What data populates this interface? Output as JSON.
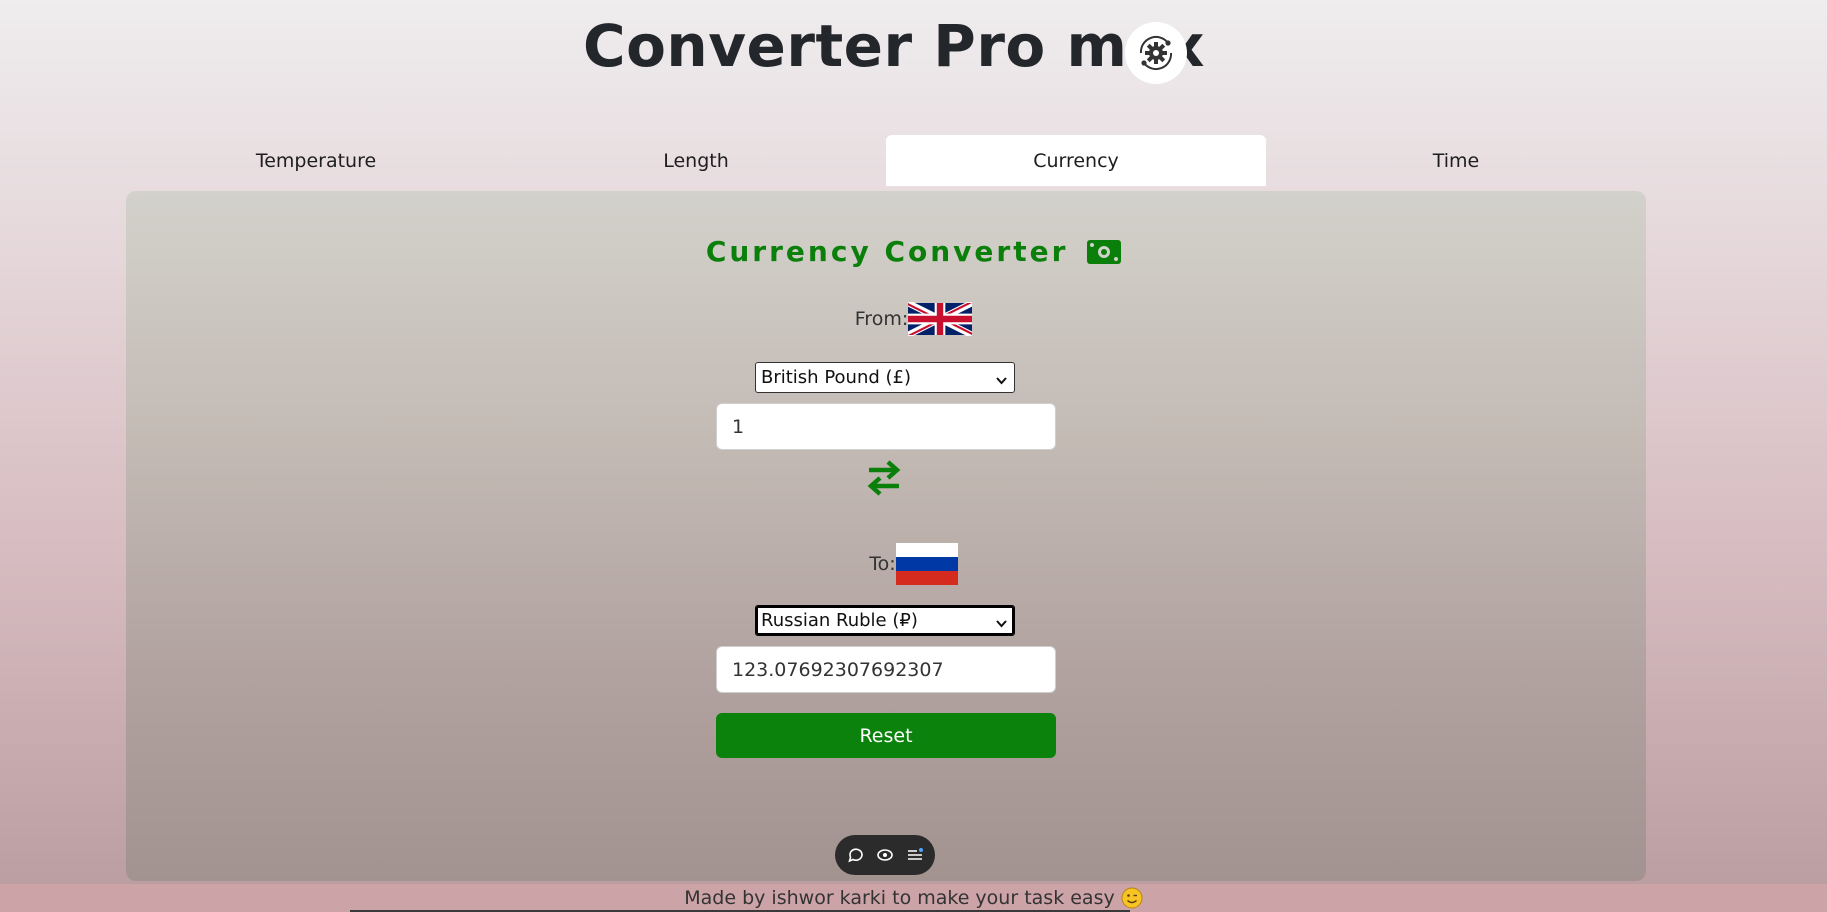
{
  "app": {
    "title": "Converter Pro max",
    "logo_icon": "gear-cycle-icon"
  },
  "tabs": [
    {
      "label": "Temperature",
      "active": false
    },
    {
      "label": "Length",
      "active": false
    },
    {
      "label": "Currency",
      "active": true
    },
    {
      "label": "Time",
      "active": false
    }
  ],
  "converter": {
    "title": "Currency Converter",
    "title_icon": "money-bill-icon",
    "from_label": "From:",
    "from_flag": "uk-flag-icon",
    "from_currency": "British Pound (£)",
    "from_value": "1",
    "swap_icon": "swap-arrows-icon",
    "to_label": "To:",
    "to_flag": "russia-flag-icon",
    "to_currency": "Russian Ruble (₽)",
    "to_value": "123.07692307692307",
    "reset_label": "Reset"
  },
  "floating_toolbar": {
    "icons": [
      "chat-icon",
      "eye-icon",
      "list-icon"
    ]
  },
  "footer": {
    "text": "Made by ishwor karki to make your task easy"
  },
  "colors": {
    "accent_green": "#0b820b",
    "title_green": "#0a7f0a",
    "footer_bg": "#cca3a6"
  }
}
